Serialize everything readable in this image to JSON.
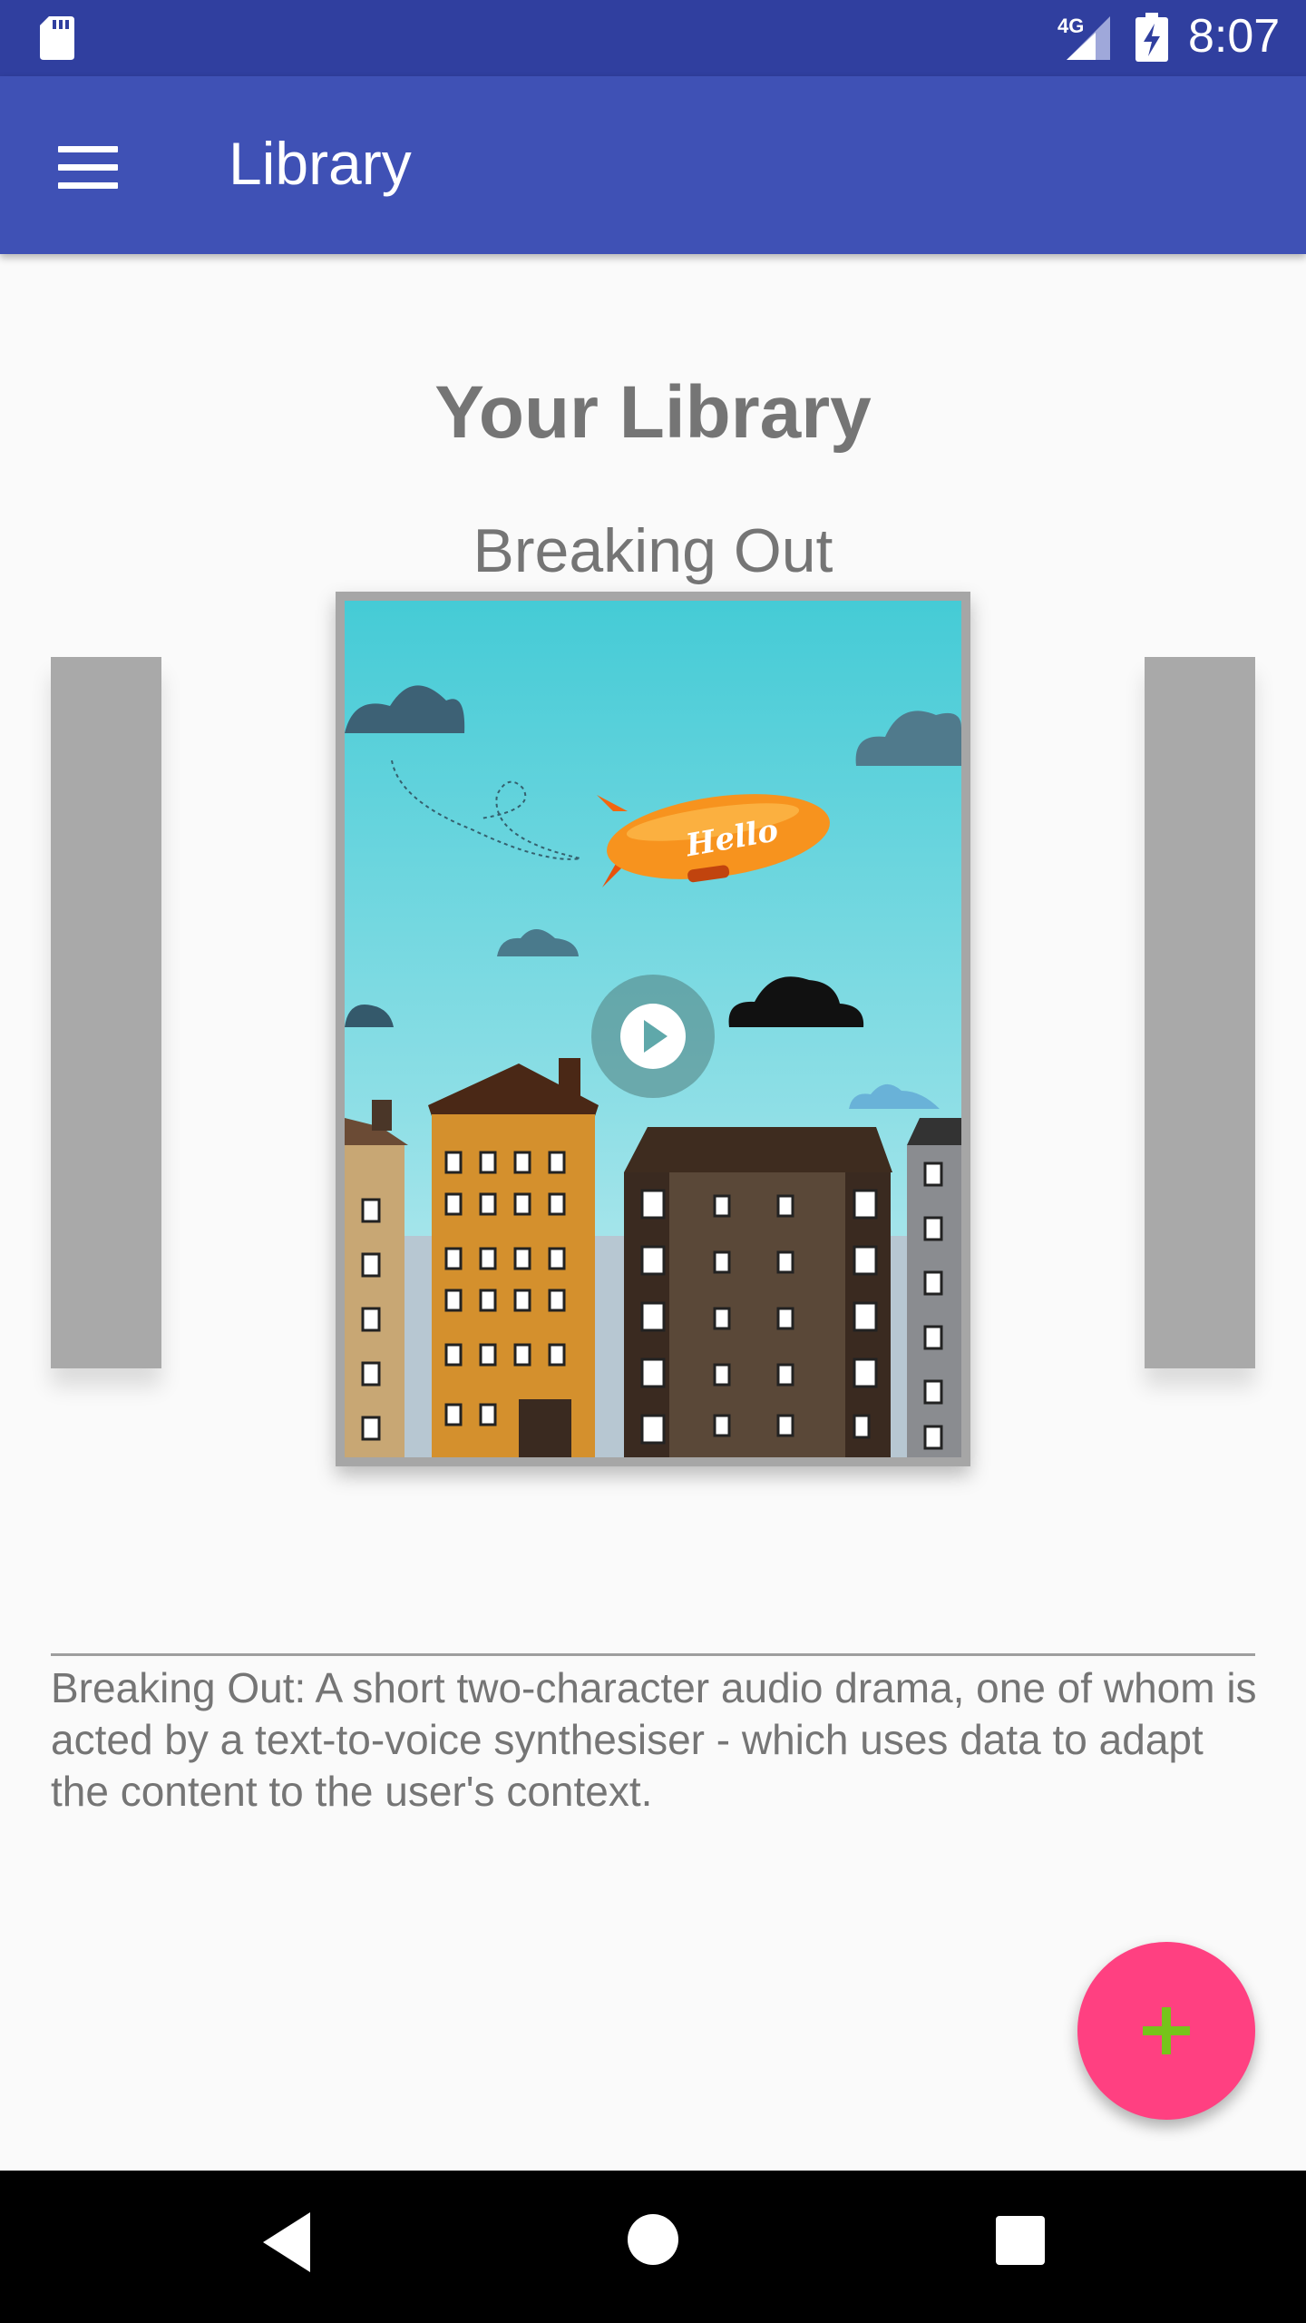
{
  "status_bar": {
    "time": "8:07",
    "network": "4G",
    "icons": [
      "sd-card-icon",
      "signal-icon",
      "battery-charging-icon"
    ]
  },
  "app_bar": {
    "title": "Library",
    "menu_icon": "hamburger-menu-icon",
    "background": "#3f51b5",
    "status_background": "#303f9f"
  },
  "library": {
    "heading": "Your Library",
    "current_book": {
      "title": "Breaking Out",
      "cover_text": "Hello",
      "play_icon": "play-icon"
    },
    "description": "Breaking Out: A short two-character audio drama, one of whom is acted by a text-to-voice synthesiser - which uses data to adapt the content to the user's context."
  },
  "fab": {
    "icon": "plus-icon",
    "color": "#ff4081",
    "icon_color": "#76c41a"
  },
  "nav_bar": {
    "icons": [
      "back-icon",
      "home-icon",
      "recents-icon"
    ]
  }
}
